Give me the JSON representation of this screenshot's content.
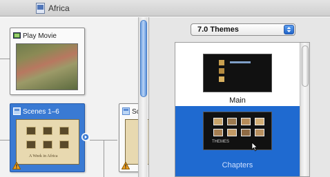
{
  "window": {
    "title": "Africa",
    "icon": "document-icon"
  },
  "canvas": {
    "nodes": [
      {
        "label": "Play Movie",
        "icon": "movie-icon",
        "selected": false,
        "warning": false
      },
      {
        "label": "Scenes 1–6",
        "icon": "menu-icon",
        "selected": true,
        "warning": true
      },
      {
        "label": "Sc",
        "icon": "menu-icon",
        "selected": false,
        "warning": true
      }
    ],
    "scene_menu_caption": "A Week in Africa"
  },
  "themes_panel": {
    "popup_value": "7.0 Themes",
    "items": [
      {
        "label": "Main",
        "selected": false
      },
      {
        "label": "Chapters",
        "selected": true
      }
    ],
    "thumb_title": "THEMES"
  },
  "colors": {
    "selection_blue": "#1f6ad0",
    "node_selected": "#3a7ad3",
    "warning": "#f0a020"
  }
}
